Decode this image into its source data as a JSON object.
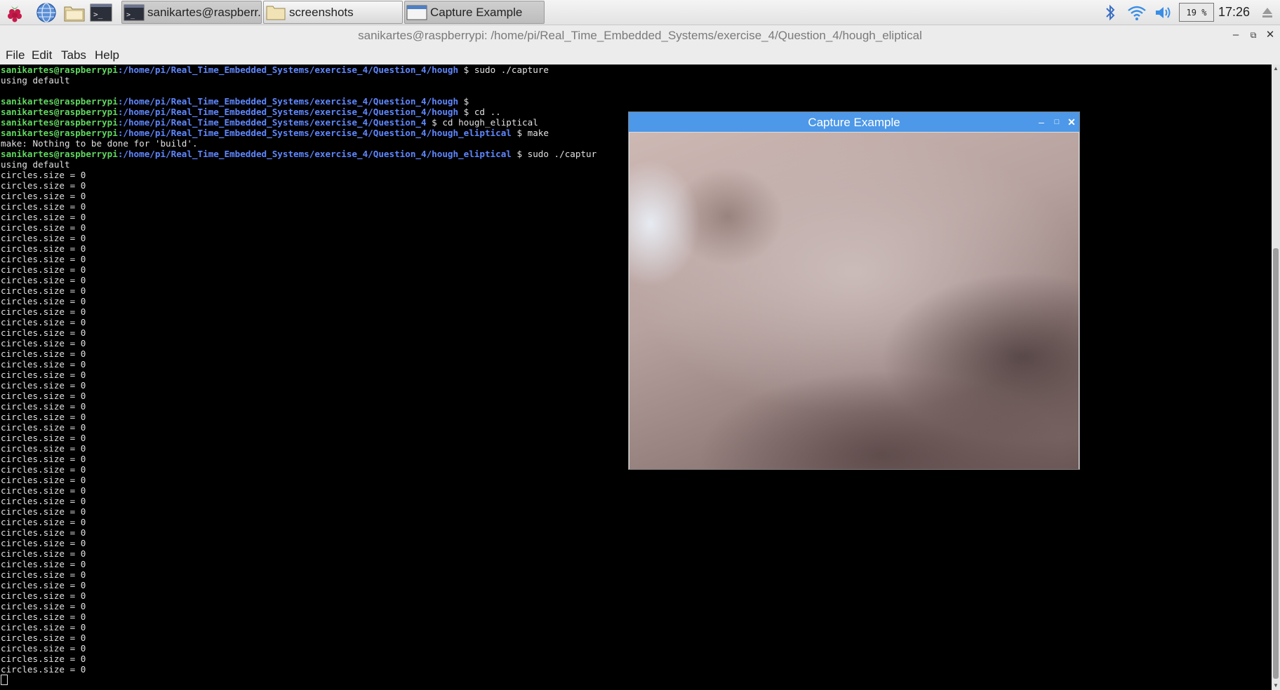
{
  "taskbar": {
    "launchers": [
      {
        "name": "raspberry-menu-icon"
      },
      {
        "name": "web-browser-icon"
      },
      {
        "name": "file-manager-icon"
      },
      {
        "name": "terminal-launcher-icon"
      }
    ],
    "tasks": [
      {
        "label": "sanikartes@raspberr...",
        "icon": "terminal-icon"
      },
      {
        "label": "screenshots",
        "icon": "folder-icon"
      },
      {
        "label": "Capture Example",
        "icon": "window-icon"
      }
    ],
    "battery": "19 %",
    "clock": "17:26"
  },
  "terminal": {
    "title": "sanikartes@raspberrypi: /home/pi/Real_Time_Embedded_Systems/exercise_4/Question_4/hough_eliptical",
    "menu": [
      "File",
      "Edit",
      "Tabs",
      "Help"
    ],
    "user": "sanikartes@raspberrypi",
    "lines": [
      {
        "path": ":/home/pi/Real_Time_Embedded_Systems/exercise_4/Question_4/hough",
        "cmd": " $ sudo ./capture"
      },
      {
        "text": "using default"
      },
      {
        "text": ""
      },
      {
        "path": ":/home/pi/Real_Time_Embedded_Systems/exercise_4/Question_4/hough",
        "cmd": " $"
      },
      {
        "path": ":/home/pi/Real_Time_Embedded_Systems/exercise_4/Question_4/hough",
        "cmd": " $ cd .."
      },
      {
        "path": ":/home/pi/Real_Time_Embedded_Systems/exercise_4/Question_4",
        "cmd": " $ cd hough_eliptical"
      },
      {
        "path": ":/home/pi/Real_Time_Embedded_Systems/exercise_4/Question_4/hough_eliptical",
        "cmd": " $ make"
      },
      {
        "text": "make: Nothing to be done for 'build'."
      },
      {
        "path": ":/home/pi/Real_Time_Embedded_Systems/exercise_4/Question_4/hough_eliptical",
        "cmd": " $ sudo ./captur"
      },
      {
        "text": "using default"
      }
    ],
    "repeat_line": "circles.size = 0",
    "repeat_count": 48
  },
  "capture_window": {
    "title": "Capture Example"
  }
}
